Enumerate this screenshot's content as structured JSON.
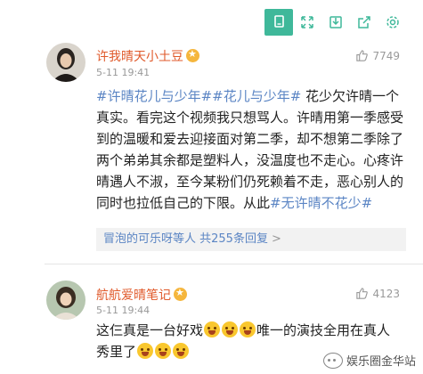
{
  "toolbar": {
    "buttons": [
      {
        "icon": "copy-icon",
        "active": true
      },
      {
        "icon": "expand-icon",
        "active": false
      },
      {
        "icon": "save-icon",
        "active": false
      },
      {
        "icon": "share-icon",
        "active": false
      },
      {
        "icon": "settings-icon",
        "active": false
      }
    ],
    "accent": "#3fb89a"
  },
  "comments": [
    {
      "username": "许我晴天小土豆",
      "time": "5-11 19:41",
      "likes": "7749",
      "tag1": "#许晴花儿与少年#",
      "tag2": "#花儿与少年#",
      "text": " 花少欠许晴一个真实。看完这个视频我只想骂人。许晴用第一季感受到的温暖和爱去迎接面对第二季，却不想第二季除了两个弟弟其余都是塑料人，没温度也不走心。心疼许晴遇人不淑，至今某粉们仍死赖着不走，恶心别人的同时也拉低自己的下限。从此",
      "tag3": "#无许晴不花少#",
      "reply_summary": "冒泡的可乐呀等人  共255条回复",
      "reply_arrow": ">"
    },
    {
      "username": "航航爱晴笔记",
      "time": "5-11 19:44",
      "likes": "4123",
      "text_a": "这仨真是一台好戏",
      "text_b": "唯一的演技全用在真人秀里了",
      "emoji_icon": "laughing-emoji"
    }
  ],
  "colors": {
    "username": "#e05a2b",
    "hashtag": "#5b85c4"
  },
  "watermark": "娱乐圈金华站"
}
